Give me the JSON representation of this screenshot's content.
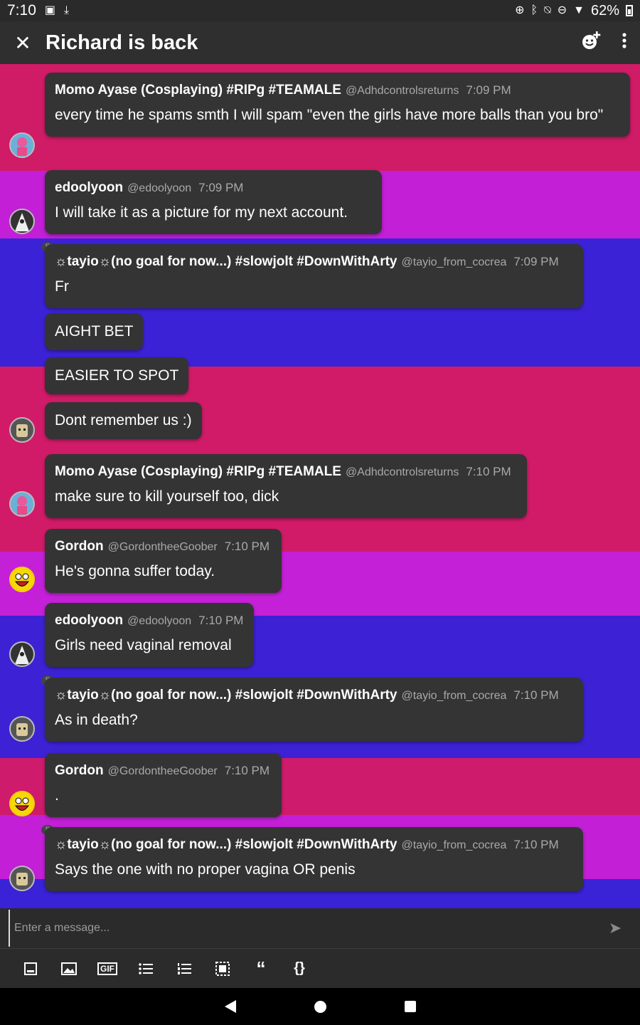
{
  "status_bar": {
    "time": "7:10",
    "battery": "62%"
  },
  "header": {
    "title": "Richard is back"
  },
  "messages": [
    {
      "sender": "Momo Ayase (Cosplaying) #RIPg #TEAMALE",
      "handle": "@Adhdcontrolsreturns",
      "time": "7:09 PM",
      "body": "every time he spams smth I will spam \"even the girls have more balls than you bro\""
    },
    {
      "sender": "edoolyoon",
      "handle": "@edoolyoon",
      "time": "7:09 PM",
      "body": "I will take it as a picture for my next account."
    },
    {
      "sender": "☼tayio☼(no goal for now...) #slowjolt #DownWithArty",
      "handle": "@tayio_from_cocrea",
      "time": "7:09 PM",
      "body": "Fr"
    },
    {
      "body": "AIGHT BET"
    },
    {
      "body": "EASIER TO SPOT"
    },
    {
      "body": "Dont remember us :)"
    },
    {
      "sender": "Momo Ayase (Cosplaying) #RIPg #TEAMALE",
      "handle": "@Adhdcontrolsreturns",
      "time": "7:10 PM",
      "body": "make sure to kill yourself too, dick"
    },
    {
      "sender": "Gordon",
      "handle": "@GordontheeGoober",
      "time": "7:10 PM",
      "body": "He's gonna suffer today."
    },
    {
      "sender": "edoolyoon",
      "handle": "@edoolyoon",
      "time": "7:10 PM",
      "body": "Girls need vaginal removal"
    },
    {
      "sender": "☼tayio☼(no goal for now...) #slowjolt #DownWithArty",
      "handle": "@tayio_from_cocrea",
      "time": "7:10 PM",
      "body": "As in death?"
    },
    {
      "sender": "Gordon",
      "handle": "@GordontheeGoober",
      "time": "7:10 PM",
      "body": "."
    },
    {
      "sender": "☼tayio☼(no goal for now...) #slowjolt #DownWithArty",
      "handle": "@tayio_from_cocrea",
      "time": "7:10 PM",
      "body": "Says the one with no proper vagina OR penis"
    }
  ],
  "composer": {
    "placeholder": "Enter a message..."
  },
  "toolbar": {
    "gif_label": "GIF"
  },
  "colors": {
    "pink": "#d21a6b",
    "purple": "#c21fd6",
    "blue": "#3a22d6",
    "bubble": "#343434"
  }
}
